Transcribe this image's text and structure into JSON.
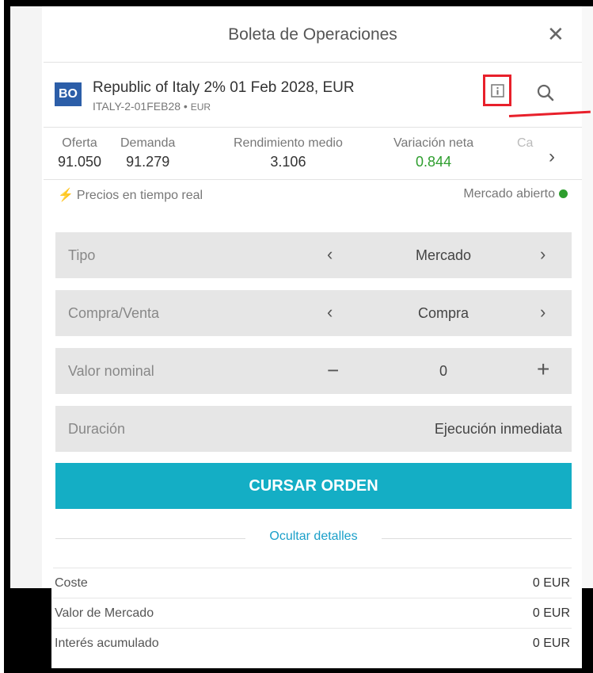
{
  "header": {
    "title": "Boleta de Operaciones",
    "close": "✕"
  },
  "instrument": {
    "badge": "BO",
    "name": "Republic of Italy 2% 01 Feb 2028, EUR",
    "symbol": "ITALY-2-01FEB28",
    "separator": "•",
    "currency": "EUR"
  },
  "prices": [
    {
      "label": "Oferta",
      "value": "91.050"
    },
    {
      "label": "Demanda",
      "value": "91.279"
    },
    {
      "label": "Rendimiento medio",
      "value": "3.106"
    },
    {
      "label": "Variación neta",
      "value": "0.844"
    },
    {
      "label": "Ca",
      "value": ""
    }
  ],
  "status": {
    "realtime": "Precios en tiempo real",
    "market": "Mercado abierto"
  },
  "form": {
    "tipo": {
      "label": "Tipo",
      "value": "Mercado"
    },
    "side": {
      "label": "Compra/Venta",
      "value": "Compra"
    },
    "nominal": {
      "label": "Valor nominal",
      "value": "0"
    },
    "duration": {
      "label": "Duración",
      "value": "Ejecución inmediata"
    }
  },
  "submit_label": "CURSAR ORDEN",
  "toggle_details": "Ocultar detalles",
  "details": [
    {
      "label": "Coste",
      "value": "0 EUR"
    },
    {
      "label": "Valor de Mercado",
      "value": "0 EUR"
    },
    {
      "label": "Interés acumulado",
      "value": "0 EUR"
    }
  ],
  "colors": {
    "accent": "#14aec5",
    "badge": "#2c5ea8",
    "positive": "#2e9e2e",
    "highlight": "#e8202b"
  }
}
